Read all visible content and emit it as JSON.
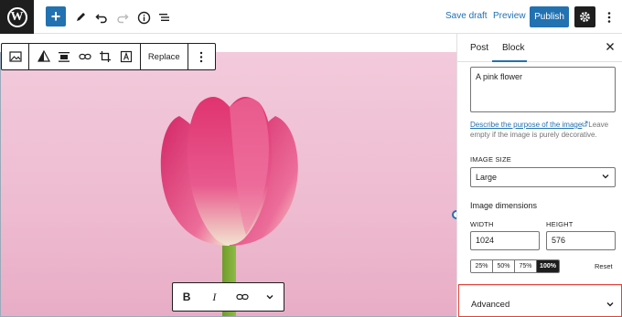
{
  "toolbar": {
    "add_icon": "plus-icon",
    "save_draft": "Save draft",
    "preview": "Preview",
    "publish": "Publish"
  },
  "block_toolbar": {
    "replace_label": "Replace"
  },
  "sidebar": {
    "tabs": [
      {
        "label": "Post"
      },
      {
        "label": "Block"
      }
    ],
    "active_tab": "Block",
    "alt_text": "A pink flower",
    "help_link": "Describe the purpose of the image",
    "help_rest": "Leave empty if the image is purely decorative.",
    "image_size_label": "IMAGE SIZE",
    "image_size_value": "Large",
    "dimensions_title": "Image dimensions",
    "width_label": "WIDTH",
    "height_label": "HEIGHT",
    "width_value": "1024",
    "height_value": "576",
    "percent_options": [
      "25%",
      "50%",
      "75%",
      "100%"
    ],
    "percent_selected": "100%",
    "reset_label": "Reset",
    "advanced_label": "Advanced"
  },
  "colors": {
    "accent": "#2271b1",
    "highlight_border": "#e0443a",
    "image_bg": "#f2cadb"
  }
}
